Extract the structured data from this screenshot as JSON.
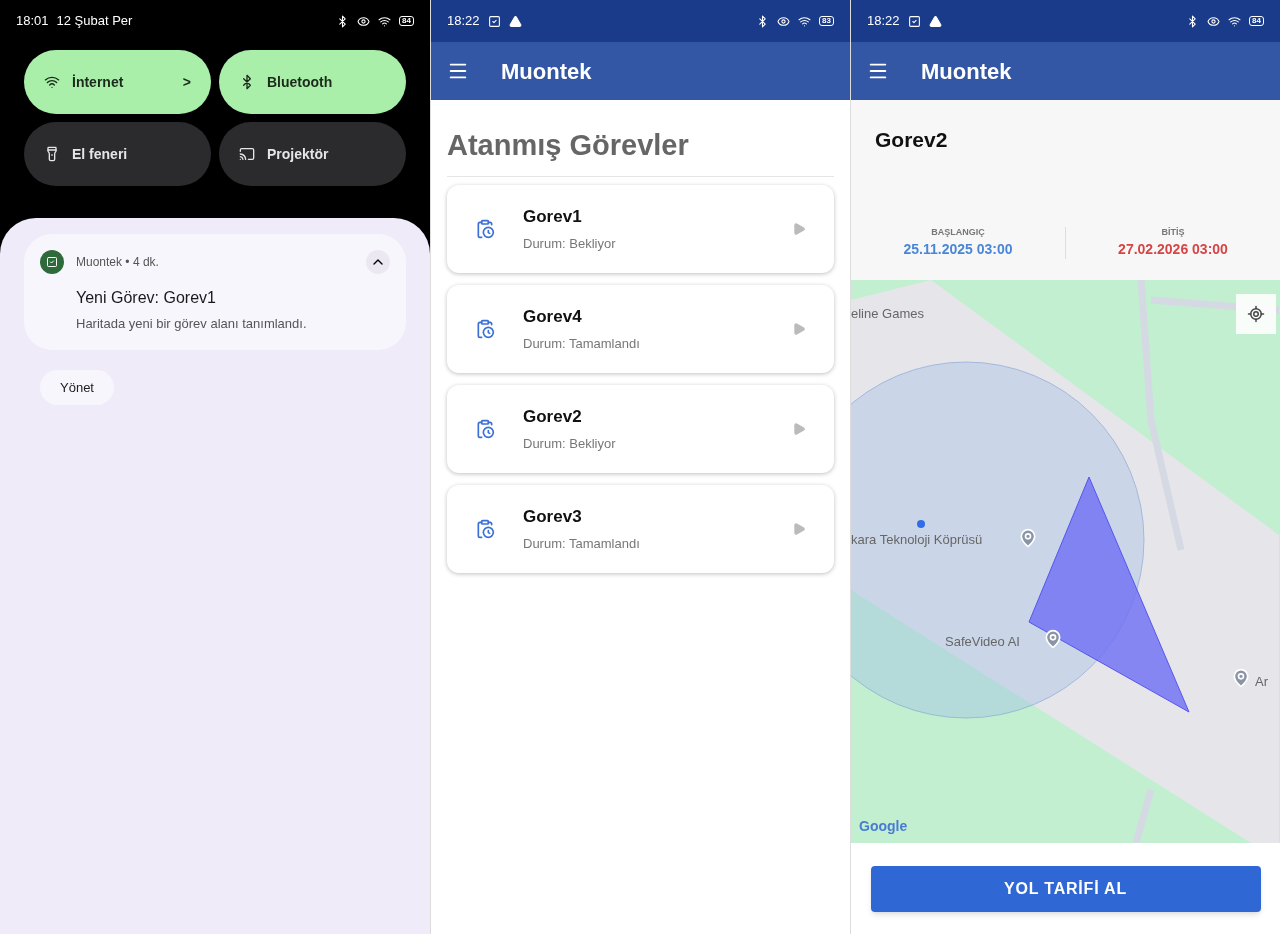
{
  "quick_settings": {
    "status_bar": {
      "time": "18:01",
      "date": "12 Şubat Per",
      "battery": "84"
    },
    "tiles": [
      {
        "label": "İnternet",
        "on": true,
        "chevron": ">"
      },
      {
        "label": "Bluetooth",
        "on": true
      },
      {
        "label": "El feneri",
        "on": false
      },
      {
        "label": "Projektör",
        "on": false
      }
    ],
    "notification": {
      "app": "Muontek • 4 dk.",
      "title": "Yeni Görev: Gorev1",
      "text": "Haritada yeni bir görev alanı tanımlandı.",
      "expanded": true
    },
    "manage_button": "Yönet"
  },
  "task_list": {
    "status_bar": {
      "time": "18:22",
      "battery": "83"
    },
    "app_title": "Muontek",
    "heading": "Atanmış Görevler",
    "tasks": [
      {
        "name": "Gorev1",
        "status": "Durum: Bekliyor"
      },
      {
        "name": "Gorev4",
        "status": "Durum: Tamamlandı"
      },
      {
        "name": "Gorev2",
        "status": "Durum: Bekliyor"
      },
      {
        "name": "Gorev3",
        "status": "Durum: Tamamlandı"
      }
    ]
  },
  "task_detail": {
    "status_bar": {
      "time": "18:22",
      "battery": "84"
    },
    "app_title": "Muontek",
    "title": "Gorev2",
    "start": {
      "label": "BAŞLANGIÇ",
      "value": "25.11.2025 03:00"
    },
    "end": {
      "label": "BİTİŞ",
      "value": "27.02.2026 03:00"
    },
    "map": {
      "labels": [
        "eline Games",
        "kara Teknoloji Köprüsü",
        "SafeVideo AI",
        "Ar"
      ],
      "attribution": "Google"
    },
    "button": "YOL TARİFİ AL"
  }
}
